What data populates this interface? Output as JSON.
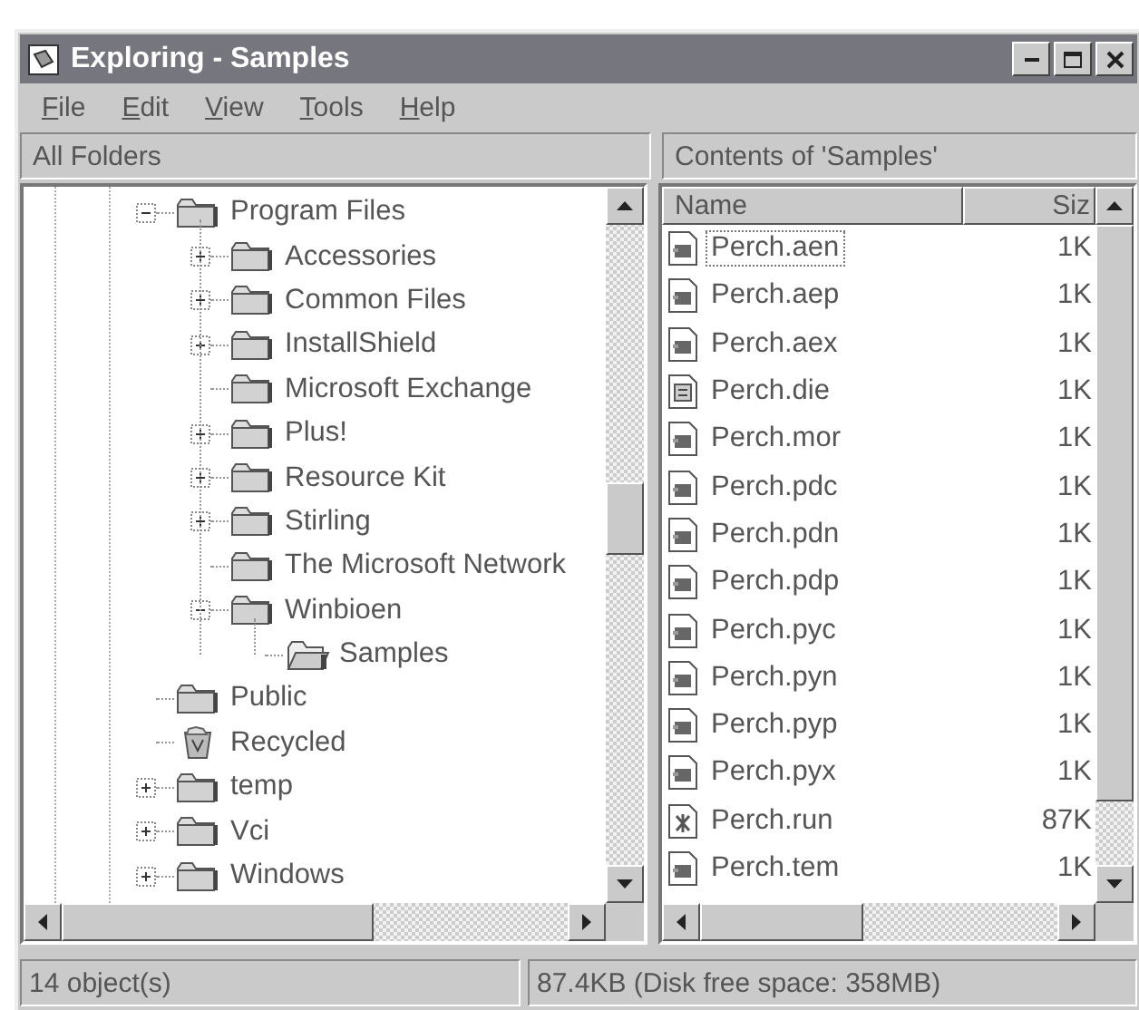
{
  "window": {
    "title": "Exploring - Samples"
  },
  "menu": [
    {
      "label": "File"
    },
    {
      "label": "Edit"
    },
    {
      "label": "View"
    },
    {
      "label": "Tools"
    },
    {
      "label": "Help"
    }
  ],
  "left_pane": {
    "header": "All Folders",
    "tree": [
      {
        "label": "Program Files",
        "kind": "folder",
        "expanded": true,
        "children": [
          {
            "label": "Accessories",
            "kind": "folder",
            "expanded": false
          },
          {
            "label": "Common Files",
            "kind": "folder",
            "expanded": false
          },
          {
            "label": "InstallShield",
            "kind": "folder",
            "expanded": false
          },
          {
            "label": "Microsoft Exchange",
            "kind": "folder"
          },
          {
            "label": "Plus!",
            "kind": "folder",
            "expanded": false
          },
          {
            "label": "Resource Kit",
            "kind": "folder",
            "expanded": false
          },
          {
            "label": "Stirling",
            "kind": "folder",
            "expanded": false
          },
          {
            "label": "The Microsoft Network",
            "kind": "folder"
          },
          {
            "label": "Winbioen",
            "kind": "folder",
            "expanded": true,
            "children": [
              {
                "label": "Samples",
                "kind": "open-folder"
              }
            ]
          }
        ]
      },
      {
        "label": "Public",
        "kind": "folder"
      },
      {
        "label": "Recycled",
        "kind": "recycle-bin"
      },
      {
        "label": "temp",
        "kind": "folder",
        "expanded": false
      },
      {
        "label": "Vci",
        "kind": "folder",
        "expanded": false
      },
      {
        "label": "Windows",
        "kind": "folder",
        "expanded": false
      }
    ]
  },
  "right_pane": {
    "header": "Contents of 'Samples'",
    "columns": [
      "Name",
      "Siz"
    ],
    "rows": [
      {
        "name": "Perch.aen",
        "size": "1K",
        "kind": "data",
        "focused": true
      },
      {
        "name": "Perch.aep",
        "size": "1K",
        "kind": "data",
        "focused": false
      },
      {
        "name": "Perch.aex",
        "size": "1K",
        "kind": "data",
        "focused": false
      },
      {
        "name": "Perch.die",
        "size": "1K",
        "kind": "note",
        "focused": false
      },
      {
        "name": "Perch.mor",
        "size": "1K",
        "kind": "data",
        "focused": false
      },
      {
        "name": "Perch.pdc",
        "size": "1K",
        "kind": "data",
        "focused": false
      },
      {
        "name": "Perch.pdn",
        "size": "1K",
        "kind": "data",
        "focused": false
      },
      {
        "name": "Perch.pdp",
        "size": "1K",
        "kind": "data",
        "focused": false
      },
      {
        "name": "Perch.pyc",
        "size": "1K",
        "kind": "data",
        "focused": false
      },
      {
        "name": "Perch.pyn",
        "size": "1K",
        "kind": "data",
        "focused": false
      },
      {
        "name": "Perch.pyp",
        "size": "1K",
        "kind": "data",
        "focused": false
      },
      {
        "name": "Perch.pyx",
        "size": "1K",
        "kind": "data",
        "focused": false
      },
      {
        "name": "Perch.run",
        "size": "87K",
        "kind": "program",
        "focused": false
      },
      {
        "name": "Perch.tem",
        "size": "1K",
        "kind": "data",
        "focused": false
      }
    ]
  },
  "status_bar": [
    "14 object(s)",
    "87.4KB (Disk free space: 358MB)"
  ]
}
